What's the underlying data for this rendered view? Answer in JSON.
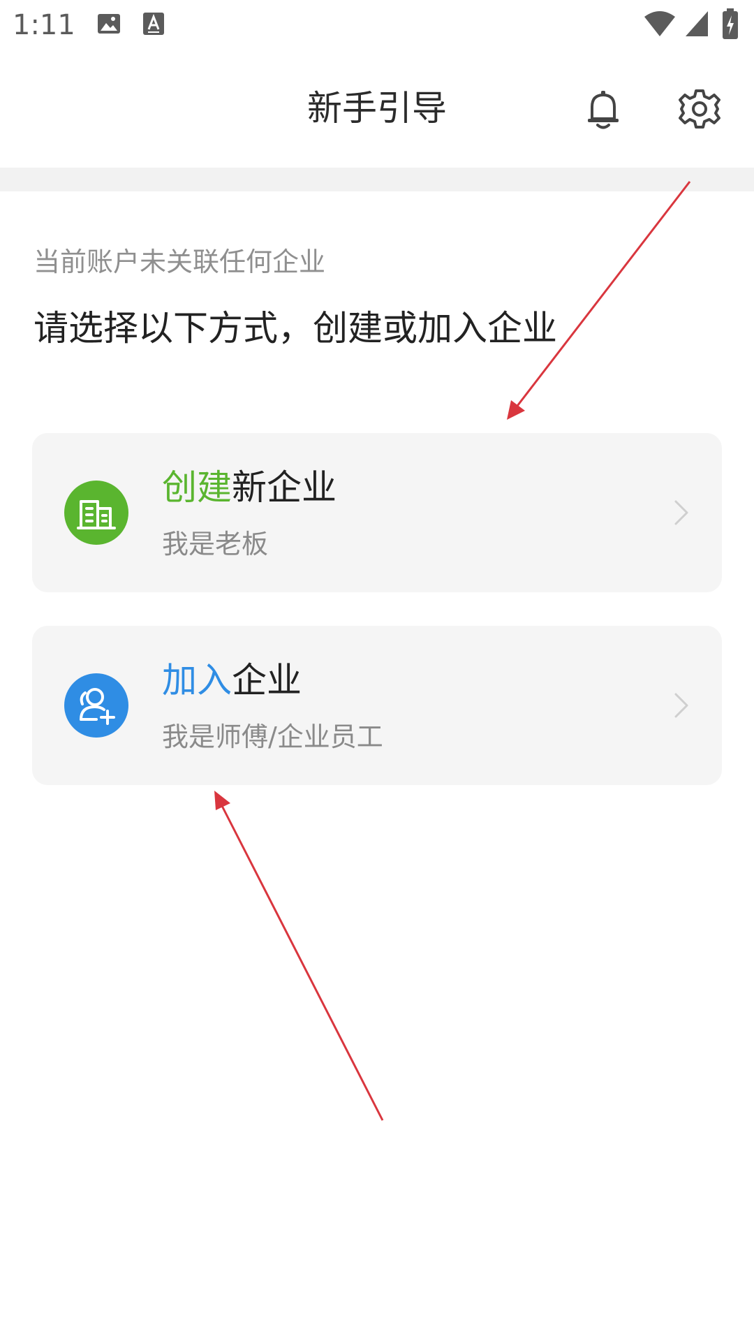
{
  "status_bar": {
    "time": "1:11"
  },
  "app_bar": {
    "title": "新手引导"
  },
  "content": {
    "hint": "当前账户未关联任何企业",
    "heading": "请选择以下方式，创建或加入企业"
  },
  "cards": [
    {
      "title_accent": "创建",
      "title_rest": "新企业",
      "subtitle": "我是老板",
      "accent_color": "#5ab52f",
      "icon": "building-icon"
    },
    {
      "title_accent": "加入",
      "title_rest": "企业",
      "subtitle": "我是师傅/企业员工",
      "accent_color": "#2f8de4",
      "icon": "add-user-icon"
    }
  ],
  "colors": {
    "annotation_arrow": "#d9363e"
  }
}
